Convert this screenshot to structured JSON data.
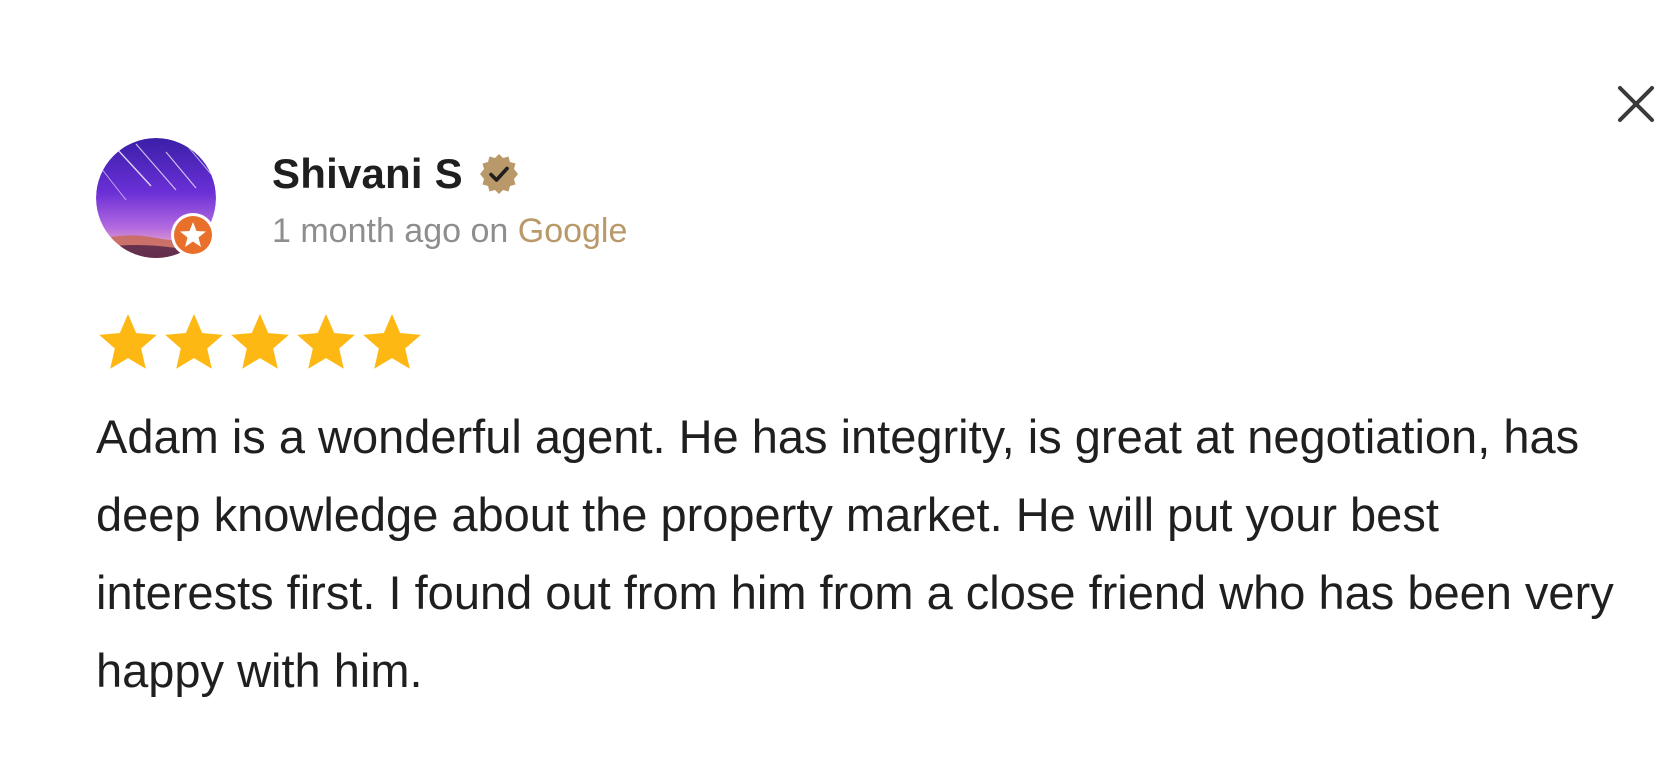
{
  "review": {
    "author_name": "Shivani S",
    "time_ago": "1 month ago on",
    "source": "Google",
    "rating": 5,
    "rating_max": 5,
    "text": "Adam is a wonderful agent. He has integrity, is great at negotiation, has deep knowledge about the property market. He will put your best interests first. I found out from him from a close friend who has been very happy with him."
  },
  "icons": {
    "close": "close-icon",
    "verified": "verified-badge-icon",
    "star": "star-icon",
    "avatar_badge": "local-guide-star-icon"
  },
  "colors": {
    "star": "#FDB813",
    "verified_badge": "#B9996A",
    "source_link": "#B9996A",
    "avatar_badge": "#E8702A",
    "text": "#1F1F1F",
    "muted": "#8E8E8E"
  }
}
